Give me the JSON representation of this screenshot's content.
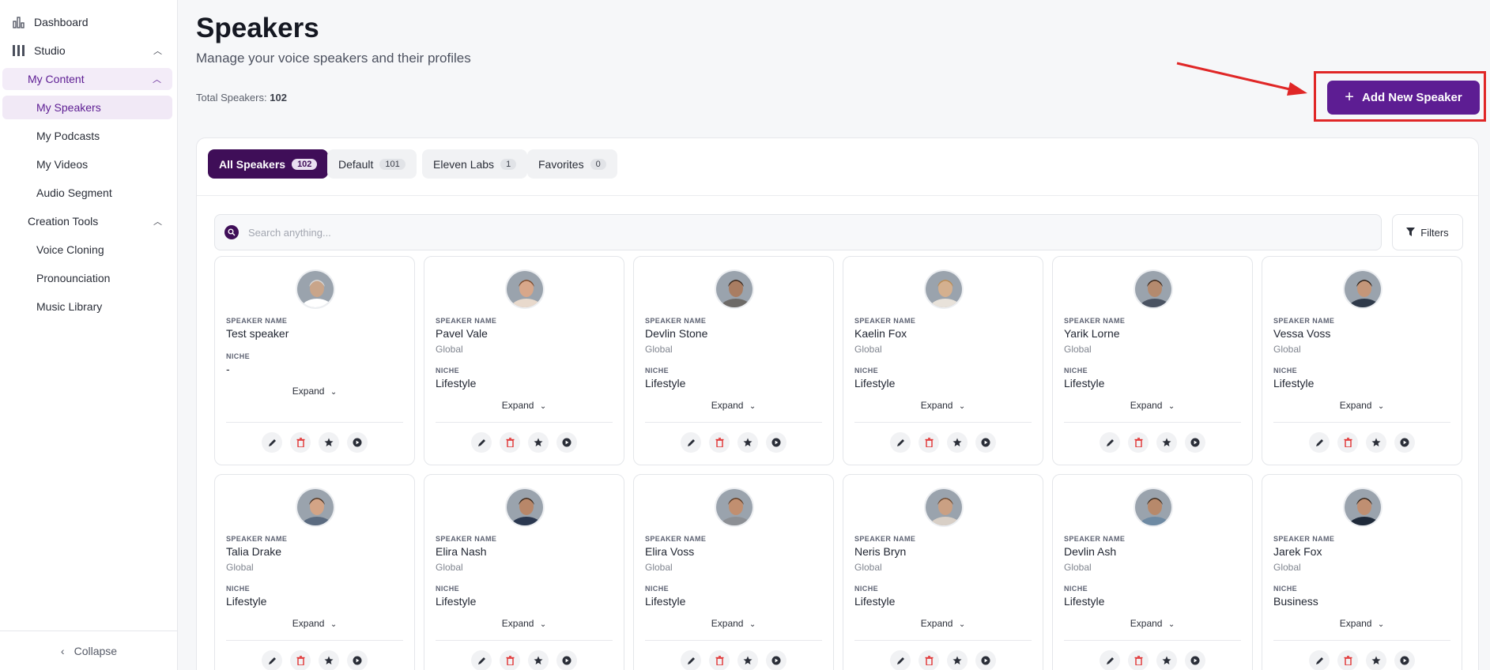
{
  "sidebar": {
    "dashboard": "Dashboard",
    "studio": "Studio",
    "my_content": "My Content",
    "items": [
      "My Speakers",
      "My Podcasts",
      "My Videos",
      "Audio Segment"
    ],
    "creation_tools": "Creation Tools",
    "tools": [
      "Voice Cloning",
      "Pronounciation",
      "Music Library"
    ],
    "collapse": "Collapse"
  },
  "header": {
    "title": "Speakers",
    "subtitle": "Manage your voice speakers and their profiles",
    "total_label": "Total Speakers:",
    "total_value": "102",
    "add_button": "Add New Speaker"
  },
  "tabs": [
    {
      "label": "All Speakers",
      "count": "102"
    },
    {
      "label": "Default",
      "count": "101"
    },
    {
      "label": "Eleven Labs",
      "count": "1"
    },
    {
      "label": "Favorites",
      "count": "0"
    }
  ],
  "search": {
    "placeholder": "Search anything..."
  },
  "filters_label": "Filters",
  "card_labels": {
    "speaker_name": "SPEAKER NAME",
    "niche": "NICHE",
    "expand": "Expand"
  },
  "speakers": [
    {
      "name": "Test speaker",
      "region": "",
      "niche": "-"
    },
    {
      "name": "Pavel Vale",
      "region": "Global",
      "niche": "Lifestyle"
    },
    {
      "name": "Devlin Stone",
      "region": "Global",
      "niche": "Lifestyle"
    },
    {
      "name": "Kaelin Fox",
      "region": "Global",
      "niche": "Lifestyle"
    },
    {
      "name": "Yarik Lorne",
      "region": "Global",
      "niche": "Lifestyle"
    },
    {
      "name": "Vessa Voss",
      "region": "Global",
      "niche": "Lifestyle"
    },
    {
      "name": "Talia Drake",
      "region": "Global",
      "niche": "Lifestyle"
    },
    {
      "name": "Elira Nash",
      "region": "Global",
      "niche": "Lifestyle"
    },
    {
      "name": "Elira Voss",
      "region": "Global",
      "niche": "Lifestyle"
    },
    {
      "name": "Neris Bryn",
      "region": "Global",
      "niche": "Lifestyle"
    },
    {
      "name": "Devlin Ash",
      "region": "Global",
      "niche": "Lifestyle"
    },
    {
      "name": "Jarek Fox",
      "region": "Global",
      "niche": "Business"
    }
  ],
  "colors": {
    "accent": "#5d1d93",
    "active_tab": "#3f0e58",
    "highlight": "#e02727",
    "delete": "#e03131"
  }
}
